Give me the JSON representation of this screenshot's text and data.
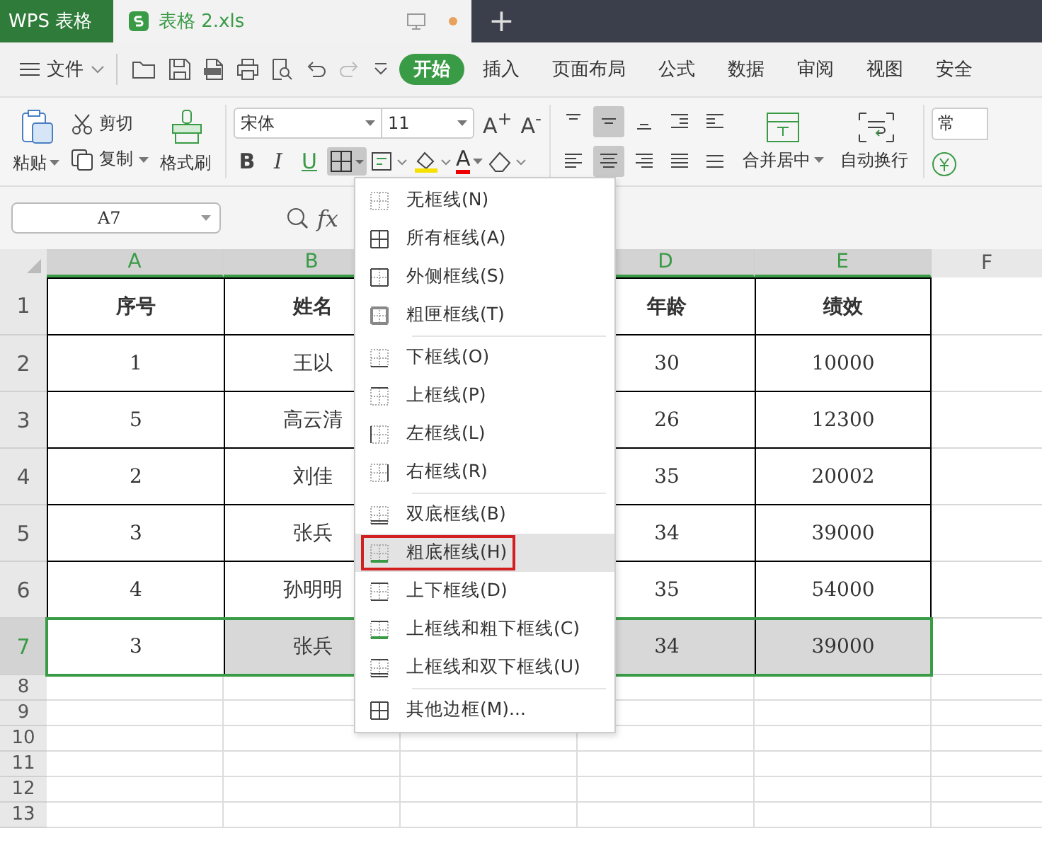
{
  "title_bar": {
    "app_tab": "WPS 表格",
    "file_tab": "表格 2.xls",
    "unsaved": true,
    "new_tab": "+"
  },
  "menu_bar": {
    "file": "文件",
    "tabs": [
      {
        "label": "开始",
        "selected": true
      },
      {
        "label": "插入",
        "selected": false
      },
      {
        "label": "页面布局",
        "selected": false
      },
      {
        "label": "公式",
        "selected": false
      },
      {
        "label": "数据",
        "selected": false
      },
      {
        "label": "审阅",
        "selected": false
      },
      {
        "label": "视图",
        "selected": false
      },
      {
        "label": "安全",
        "selected": false
      }
    ]
  },
  "ribbon": {
    "paste": "粘贴",
    "cut": "剪切",
    "copy": "复制",
    "format_painter": "格式刷",
    "font": "宋体",
    "font_size": "11",
    "grow_font": "A$^{+}$",
    "shrink_font": "A$^{-}$",
    "bold": "B",
    "italic": "I",
    "underline": "U",
    "font_color": "A",
    "border_button_open": true,
    "alignment": [
      {
        "kind": "top",
        "selected": false
      },
      {
        "kind": "middle",
        "selected": true
      },
      {
        "kind": "bottom",
        "selected": false
      },
      {
        "kind": "outdent",
        "selected": false
      },
      {
        "kind": "indent",
        "selected": false
      },
      {
        "kind": "left",
        "selected": false
      },
      {
        "kind": "center",
        "selected": true
      },
      {
        "kind": "right",
        "selected": false
      },
      {
        "kind": "justify",
        "selected": false
      },
      {
        "kind": "distributed",
        "selected": false
      }
    ],
    "merge_center": "合并居中",
    "wrap_text": "自动换行",
    "number_format": "常"
  },
  "formula_bar": {
    "name_box": "A7",
    "fx": "fx"
  },
  "sheet": {
    "columns": [
      {
        "label": "A",
        "selected": true
      },
      {
        "label": "B",
        "selected": true
      },
      {
        "label": "D",
        "selected": true
      },
      {
        "label": "E",
        "selected": true
      },
      {
        "label": "F",
        "selected": false
      }
    ],
    "rows": [
      {
        "number": "1",
        "selected": false,
        "cells": [
          "序号",
          "姓名",
          "年龄",
          "绩效"
        ]
      },
      {
        "number": "2",
        "selected": false,
        "cells": [
          "1",
          "王以",
          "30",
          "10000"
        ]
      },
      {
        "number": "3",
        "selected": false,
        "cells": [
          "5",
          "高云清",
          "26",
          "12300"
        ]
      },
      {
        "number": "4",
        "selected": false,
        "cells": [
          "2",
          "刘佳",
          "35",
          "20002"
        ]
      },
      {
        "number": "5",
        "selected": false,
        "cells": [
          "3",
          "张兵",
          "34",
          "39000"
        ]
      },
      {
        "number": "6",
        "selected": false,
        "cells": [
          "4",
          "孙明明",
          "35",
          "54000"
        ]
      },
      {
        "number": "7",
        "selected": true,
        "cells": [
          "3",
          "张兵",
          "34",
          "39000"
        ]
      }
    ],
    "empty_rows": [
      "8",
      "9",
      "10",
      "11",
      "12",
      "13"
    ]
  },
  "border_menu": {
    "groups": [
      [
        {
          "label": "无框线(N)",
          "kind": "none",
          "highlighted": false
        },
        {
          "label": "所有框线(A)",
          "kind": "all",
          "highlighted": false
        },
        {
          "label": "外侧框线(S)",
          "kind": "outside",
          "highlighted": false
        },
        {
          "label": "粗匣框线(T)",
          "kind": "thick_box",
          "highlighted": false
        }
      ],
      [
        {
          "label": "下框线(O)",
          "kind": "bottom",
          "highlighted": false
        },
        {
          "label": "上框线(P)",
          "kind": "top",
          "highlighted": false
        },
        {
          "label": "左框线(L)",
          "kind": "left",
          "highlighted": false
        },
        {
          "label": "右框线(R)",
          "kind": "right",
          "highlighted": false
        }
      ],
      [
        {
          "label": "双底框线(B)",
          "kind": "double_bottom",
          "highlighted": false
        },
        {
          "label": "粗底框线(H)",
          "kind": "thick_bottom",
          "highlighted": true
        },
        {
          "label": "上下框线(D)",
          "kind": "top_bottom",
          "highlighted": false
        },
        {
          "label": "上框线和粗下框线(C)",
          "kind": "top_thick_bottom",
          "highlighted": false
        },
        {
          "label": "上框线和双下框线(U)",
          "kind": "top_double_bottom",
          "highlighted": false
        }
      ],
      [
        {
          "label": "其他边框(M)...",
          "kind": "more",
          "highlighted": false
        }
      ]
    ]
  }
}
